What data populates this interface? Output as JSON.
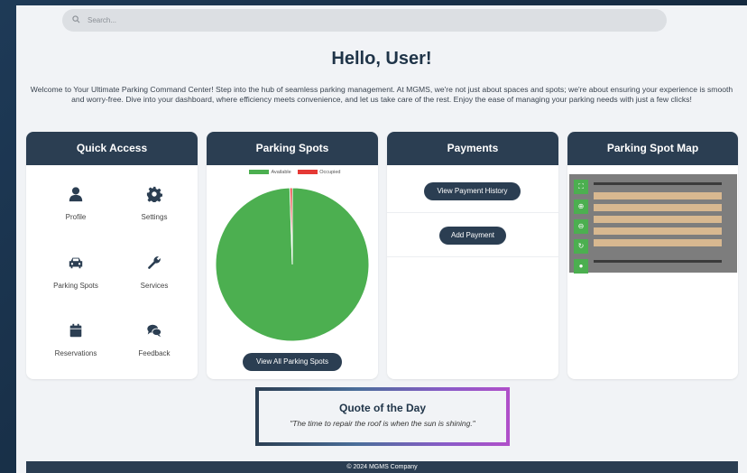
{
  "search": {
    "placeholder": "Search..."
  },
  "greeting": "Hello, User!",
  "welcome": "Welcome to Your Ultimate Parking Command Center! Step into the hub of seamless parking management. At MGMS, we're not just about spaces and spots; we're about ensuring your experience is smooth and worry-free. Dive into your dashboard, where efficiency meets convenience, and let us take care of the rest. Enjoy the ease of managing your parking needs with just a few clicks!",
  "cards": {
    "quick_access": {
      "title": "Quick Access",
      "items": [
        {
          "label": "Profile",
          "icon": "user-icon"
        },
        {
          "label": "Settings",
          "icon": "gear-icon"
        },
        {
          "label": "Parking Spots",
          "icon": "car-icon"
        },
        {
          "label": "Services",
          "icon": "wrench-icon"
        },
        {
          "label": "Reservations",
          "icon": "calendar-icon"
        },
        {
          "label": "Feedback",
          "icon": "chat-icon"
        }
      ]
    },
    "parking_spots": {
      "title": "Parking Spots",
      "button": "View All Parking Spots"
    },
    "payments": {
      "title": "Payments",
      "buttons": [
        "View Payment History",
        "Add Payment"
      ]
    },
    "map": {
      "title": "Parking Spot Map",
      "controls": [
        "fullscreen-icon",
        "zoom-in-icon",
        "zoom-out-icon",
        "reset-icon",
        "info-icon"
      ]
    }
  },
  "chart_data": {
    "type": "pie",
    "legend": [
      "Available",
      "Occupied"
    ],
    "values": [
      99.5,
      0.5
    ],
    "colors": [
      "#4caf50",
      "#e53935"
    ],
    "legend_position": "top"
  },
  "quote": {
    "title": "Quote of the Day",
    "text": "\"The time to repair the roof is when the sun is shining.\""
  },
  "footer": "© 2024 MGMS Company"
}
